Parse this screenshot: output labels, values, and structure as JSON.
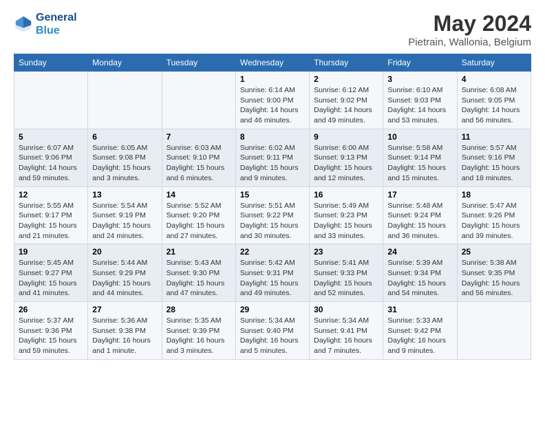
{
  "header": {
    "logo_line1": "General",
    "logo_line2": "Blue",
    "title": "May 2024",
    "subtitle": "Pietrain, Wallonia, Belgium"
  },
  "columns": [
    "Sunday",
    "Monday",
    "Tuesday",
    "Wednesday",
    "Thursday",
    "Friday",
    "Saturday"
  ],
  "weeks": [
    {
      "days": [
        {
          "num": "",
          "info": ""
        },
        {
          "num": "",
          "info": ""
        },
        {
          "num": "",
          "info": ""
        },
        {
          "num": "1",
          "info": "Sunrise: 6:14 AM\nSunset: 9:00 PM\nDaylight: 14 hours\nand 46 minutes."
        },
        {
          "num": "2",
          "info": "Sunrise: 6:12 AM\nSunset: 9:02 PM\nDaylight: 14 hours\nand 49 minutes."
        },
        {
          "num": "3",
          "info": "Sunrise: 6:10 AM\nSunset: 9:03 PM\nDaylight: 14 hours\nand 53 minutes."
        },
        {
          "num": "4",
          "info": "Sunrise: 6:08 AM\nSunset: 9:05 PM\nDaylight: 14 hours\nand 56 minutes."
        }
      ]
    },
    {
      "days": [
        {
          "num": "5",
          "info": "Sunrise: 6:07 AM\nSunset: 9:06 PM\nDaylight: 14 hours\nand 59 minutes."
        },
        {
          "num": "6",
          "info": "Sunrise: 6:05 AM\nSunset: 9:08 PM\nDaylight: 15 hours\nand 3 minutes."
        },
        {
          "num": "7",
          "info": "Sunrise: 6:03 AM\nSunset: 9:10 PM\nDaylight: 15 hours\nand 6 minutes."
        },
        {
          "num": "8",
          "info": "Sunrise: 6:02 AM\nSunset: 9:11 PM\nDaylight: 15 hours\nand 9 minutes."
        },
        {
          "num": "9",
          "info": "Sunrise: 6:00 AM\nSunset: 9:13 PM\nDaylight: 15 hours\nand 12 minutes."
        },
        {
          "num": "10",
          "info": "Sunrise: 5:58 AM\nSunset: 9:14 PM\nDaylight: 15 hours\nand 15 minutes."
        },
        {
          "num": "11",
          "info": "Sunrise: 5:57 AM\nSunset: 9:16 PM\nDaylight: 15 hours\nand 18 minutes."
        }
      ]
    },
    {
      "days": [
        {
          "num": "12",
          "info": "Sunrise: 5:55 AM\nSunset: 9:17 PM\nDaylight: 15 hours\nand 21 minutes."
        },
        {
          "num": "13",
          "info": "Sunrise: 5:54 AM\nSunset: 9:19 PM\nDaylight: 15 hours\nand 24 minutes."
        },
        {
          "num": "14",
          "info": "Sunrise: 5:52 AM\nSunset: 9:20 PM\nDaylight: 15 hours\nand 27 minutes."
        },
        {
          "num": "15",
          "info": "Sunrise: 5:51 AM\nSunset: 9:22 PM\nDaylight: 15 hours\nand 30 minutes."
        },
        {
          "num": "16",
          "info": "Sunrise: 5:49 AM\nSunset: 9:23 PM\nDaylight: 15 hours\nand 33 minutes."
        },
        {
          "num": "17",
          "info": "Sunrise: 5:48 AM\nSunset: 9:24 PM\nDaylight: 15 hours\nand 36 minutes."
        },
        {
          "num": "18",
          "info": "Sunrise: 5:47 AM\nSunset: 9:26 PM\nDaylight: 15 hours\nand 39 minutes."
        }
      ]
    },
    {
      "days": [
        {
          "num": "19",
          "info": "Sunrise: 5:45 AM\nSunset: 9:27 PM\nDaylight: 15 hours\nand 41 minutes."
        },
        {
          "num": "20",
          "info": "Sunrise: 5:44 AM\nSunset: 9:29 PM\nDaylight: 15 hours\nand 44 minutes."
        },
        {
          "num": "21",
          "info": "Sunrise: 5:43 AM\nSunset: 9:30 PM\nDaylight: 15 hours\nand 47 minutes."
        },
        {
          "num": "22",
          "info": "Sunrise: 5:42 AM\nSunset: 9:31 PM\nDaylight: 15 hours\nand 49 minutes."
        },
        {
          "num": "23",
          "info": "Sunrise: 5:41 AM\nSunset: 9:33 PM\nDaylight: 15 hours\nand 52 minutes."
        },
        {
          "num": "24",
          "info": "Sunrise: 5:39 AM\nSunset: 9:34 PM\nDaylight: 15 hours\nand 54 minutes."
        },
        {
          "num": "25",
          "info": "Sunrise: 5:38 AM\nSunset: 9:35 PM\nDaylight: 15 hours\nand 56 minutes."
        }
      ]
    },
    {
      "days": [
        {
          "num": "26",
          "info": "Sunrise: 5:37 AM\nSunset: 9:36 PM\nDaylight: 15 hours\nand 59 minutes."
        },
        {
          "num": "27",
          "info": "Sunrise: 5:36 AM\nSunset: 9:38 PM\nDaylight: 16 hours\nand 1 minute."
        },
        {
          "num": "28",
          "info": "Sunrise: 5:35 AM\nSunset: 9:39 PM\nDaylight: 16 hours\nand 3 minutes."
        },
        {
          "num": "29",
          "info": "Sunrise: 5:34 AM\nSunset: 9:40 PM\nDaylight: 16 hours\nand 5 minutes."
        },
        {
          "num": "30",
          "info": "Sunrise: 5:34 AM\nSunset: 9:41 PM\nDaylight: 16 hours\nand 7 minutes."
        },
        {
          "num": "31",
          "info": "Sunrise: 5:33 AM\nSunset: 9:42 PM\nDaylight: 16 hours\nand 9 minutes."
        },
        {
          "num": "",
          "info": ""
        }
      ]
    }
  ]
}
